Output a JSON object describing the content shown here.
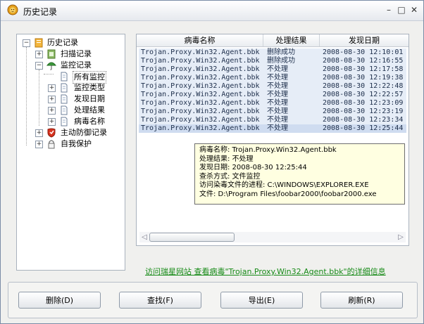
{
  "window": {
    "title": "历史记录",
    "controls": [
      "minimize-icon",
      "maximize-icon",
      "close-icon"
    ]
  },
  "tree": {
    "root": {
      "label": "历史记录",
      "icon": "history-icon"
    },
    "items": [
      {
        "label": "扫描记录",
        "icon": "scan-icon"
      },
      {
        "label": "监控记录",
        "icon": "umbrella-icon"
      },
      {
        "label": "所有监控",
        "icon": "page-icon",
        "selected": true
      },
      {
        "label": "监控类型",
        "icon": "page-icon"
      },
      {
        "label": "发现日期",
        "icon": "page-icon"
      },
      {
        "label": "处理结果",
        "icon": "page-icon"
      },
      {
        "label": "病毒名称",
        "icon": "page-icon"
      },
      {
        "label": "主动防御记录",
        "icon": "shield-icon"
      },
      {
        "label": "自我保护",
        "icon": "lock-icon"
      }
    ]
  },
  "list": {
    "columns": [
      "病毒名称",
      "处理结果",
      "发现日期"
    ],
    "rows": [
      {
        "name": "Trojan.Proxy.Win32.Agent.bbk",
        "result": "删除成功",
        "date": "2008-08-30 12:10:01"
      },
      {
        "name": "Trojan.Proxy.Win32.Agent.bbk",
        "result": "删除成功",
        "date": "2008-08-30 12:16:55"
      },
      {
        "name": "Trojan.Proxy.Win32.Agent.bbk",
        "result": "不处理",
        "date": "2008-08-30 12:17:58"
      },
      {
        "name": "Trojan.Proxy.Win32.Agent.bbk",
        "result": "不处理",
        "date": "2008-08-30 12:19:38"
      },
      {
        "name": "Trojan.Proxy.Win32.Agent.bbk",
        "result": "不处理",
        "date": "2008-08-30 12:22:48"
      },
      {
        "name": "Trojan.Proxy.Win32.Agent.bbk",
        "result": "不处理",
        "date": "2008-08-30 12:22:57"
      },
      {
        "name": "Trojan.Proxy.Win32.Agent.bbk",
        "result": "不处理",
        "date": "2008-08-30 12:23:09"
      },
      {
        "name": "Trojan.Proxy.Win32.Agent.bbk",
        "result": "不处理",
        "date": "2008-08-30 12:23:19"
      },
      {
        "name": "Trojan.Proxy.Win32.Agent.bbk",
        "result": "不处理",
        "date": "2008-08-30 12:23:34"
      },
      {
        "name": "Trojan.Proxy.Win32.Agent.bbk",
        "result": "不处理",
        "date": "2008-08-30 12:25:44",
        "selected": true
      }
    ]
  },
  "tooltip": {
    "lines": [
      "病毒名称: Trojan.Proxy.Win32.Agent.bbk",
      "处理结果: 不处理",
      "发现日期: 2008-08-30 12:25:44",
      "查杀方式: 文件监控",
      "访问染毒文件的进程: C:\\WINDOWS\\EXPLORER.EXE",
      "文件: D:\\Program Files\\foobar2000\\foobar2000.exe"
    ]
  },
  "link": {
    "text": "访问瑞星网站 查看病毒\"Trojan.Proxy.Win32.Agent.bbk\"的详细信息"
  },
  "buttons": {
    "delete": "删除(D)",
    "find": "查找(F)",
    "export": "导出(E)",
    "refresh": "刷新(R)"
  },
  "colors": {
    "row_bg": "#e6edf7",
    "row_selected_bg": "#cfdcf0",
    "tooltip_bg": "#ffffe1",
    "link": "#168a16"
  }
}
